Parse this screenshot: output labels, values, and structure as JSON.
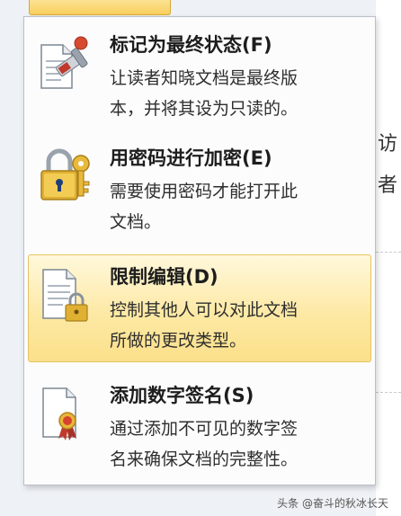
{
  "menu": {
    "items": [
      {
        "title": "标记为最终状态(F)",
        "desc": [
          "让读者知晓文档是最终版",
          "本，并将其设为只读的。"
        ],
        "icon": "mark-final-icon",
        "highlighted": false
      },
      {
        "title": "用密码进行加密(E)",
        "desc": [
          "需要使用密码才能打开此",
          "文档。"
        ],
        "icon": "padlock-key-icon",
        "highlighted": false
      },
      {
        "title": "限制编辑(D)",
        "desc": [
          "控制其他人可以对此文档",
          "所做的更改类型。"
        ],
        "icon": "restrict-editing-icon",
        "highlighted": true
      },
      {
        "title": "添加数字签名(S)",
        "desc": [
          "通过添加不可见的数字签",
          "名来确保文档的完整性。"
        ],
        "icon": "digital-signature-icon",
        "highlighted": false
      }
    ]
  },
  "background": {
    "chars": [
      "访",
      "者"
    ]
  },
  "watermark": "头条 @奋斗的秋冰长天"
}
